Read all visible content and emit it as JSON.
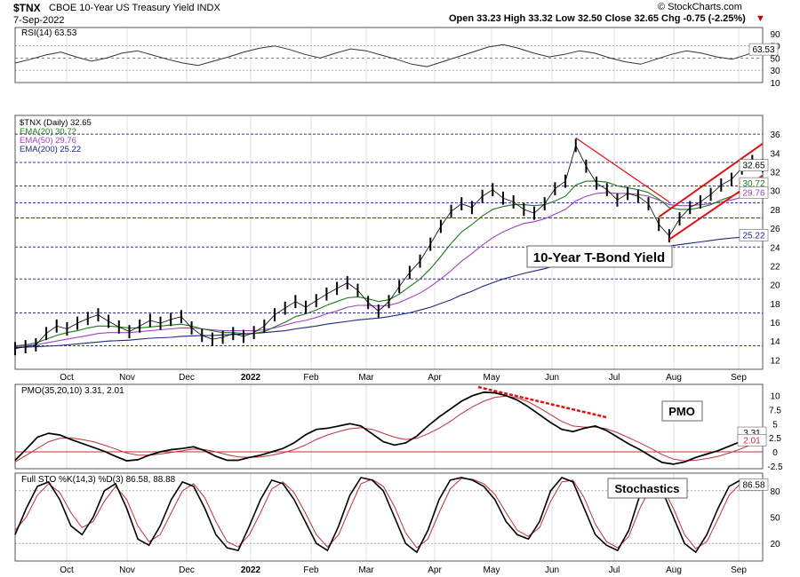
{
  "header": {
    "symbol": "$TNX",
    "description": "CBOE 10-Year US Treasury Yield INDX",
    "date": "7-Sep-2022",
    "ohlc_text": "Open 33.23  High 33.32  Low 32.50  Close 32.65  Chg -0.75 (-2.25%)",
    "credit": "© StockCharts.com",
    "down_arrow": "▼"
  },
  "colors": {
    "price": "#000000",
    "ema20": "#1a7a1a",
    "ema50": "#a040c0",
    "ema200": "#1c2a80",
    "pmo_signal": "#c0303a",
    "stoch_d": "#c0303a",
    "trend": "#e01010",
    "grid": "#333399"
  },
  "chart_data": [
    {
      "type": "line",
      "panel": "RSI",
      "label": "RSI(14) 63.53",
      "value": 63.53,
      "ylim": [
        10,
        100
      ],
      "yticks": [
        90,
        70,
        50,
        30,
        10
      ],
      "series": [
        {
          "name": "RSI(14)",
          "values": [
            42,
            48,
            55,
            60,
            52,
            45,
            50,
            58,
            62,
            55,
            48,
            42,
            38,
            45,
            52,
            60,
            66,
            70,
            64,
            56,
            50,
            58,
            65,
            62,
            55,
            48,
            40,
            36,
            44,
            52,
            60,
            68,
            72,
            66,
            58,
            52,
            56,
            62,
            58,
            50,
            44,
            40,
            48,
            56,
            62,
            58,
            52,
            48,
            56,
            63.53
          ]
        }
      ]
    },
    {
      "type": "line",
      "panel": "Price",
      "title": "10-Year T-Bond Yield",
      "ylim": [
        11,
        38
      ],
      "yticks": [
        36,
        34,
        32,
        30,
        28,
        26,
        24,
        22,
        20,
        18,
        16,
        14,
        12
      ],
      "legend": [
        {
          "label": "$TNX (Daily) 32.65",
          "color": "#000000"
        },
        {
          "label": "EMA(20) 30.72",
          "color": "#1a7a1a"
        },
        {
          "label": "EMA(50) 29.76",
          "color": "#a040c0"
        },
        {
          "label": "EMA(200) 25.22",
          "color": "#1c2a80"
        }
      ],
      "x_labels": [
        "Oct",
        "Nov",
        "Dec",
        "2022",
        "Feb",
        "Mar",
        "Apr",
        "May",
        "Jun",
        "Jul",
        "Aug",
        "Sep"
      ],
      "last_value_labels": [
        "32.65",
        "30.72",
        "29.76",
        "25.22"
      ],
      "series": [
        {
          "name": "$TNX",
          "values": [
            13.2,
            13.4,
            13.6,
            14.8,
            15.6,
            15.3,
            15.9,
            16.4,
            16.8,
            16.1,
            15.5,
            15.0,
            15.6,
            16.2,
            15.9,
            16.3,
            16.6,
            15.4,
            14.6,
            14.2,
            14.4,
            14.8,
            14.5,
            14.9,
            15.6,
            16.8,
            17.5,
            18.2,
            17.6,
            18.3,
            19.0,
            19.6,
            20.2,
            19.4,
            18.1,
            17.2,
            18.2,
            19.8,
            21.3,
            22.5,
            24.3,
            26.2,
            27.8,
            28.6,
            28.2,
            29.4,
            30.1,
            29.2,
            28.8,
            28.0,
            27.6,
            28.6,
            30.2,
            31.0,
            34.8,
            32.6,
            30.8,
            30.1,
            29.0,
            29.7,
            29.4,
            28.6,
            26.4,
            25.2,
            27.0,
            28.2,
            28.8,
            29.6,
            30.6,
            31.2,
            32.4,
            33.1,
            32.65
          ]
        },
        {
          "name": "EMA(20)",
          "values": [
            13.5,
            13.6,
            13.8,
            14.2,
            14.6,
            14.9,
            15.1,
            15.4,
            15.6,
            15.6,
            15.5,
            15.4,
            15.4,
            15.5,
            15.6,
            15.7,
            15.8,
            15.6,
            15.3,
            15.1,
            14.9,
            14.9,
            14.8,
            14.8,
            15.0,
            15.5,
            16.0,
            16.6,
            16.9,
            17.3,
            17.8,
            18.2,
            18.6,
            18.7,
            18.5,
            18.2,
            18.4,
            19.0,
            19.8,
            20.6,
            21.7,
            23.0,
            24.4,
            25.6,
            26.4,
            27.3,
            28.0,
            28.3,
            28.5,
            28.5,
            28.4,
            28.5,
            28.9,
            29.4,
            30.6,
            31.0,
            31.0,
            30.9,
            30.5,
            30.3,
            30.1,
            29.8,
            29.1,
            28.2,
            28.0,
            28.0,
            28.2,
            28.5,
            29.0,
            29.4,
            29.9,
            30.4,
            30.72
          ]
        },
        {
          "name": "EMA(50)",
          "values": [
            13.4,
            13.5,
            13.6,
            13.8,
            14.0,
            14.2,
            14.4,
            14.6,
            14.8,
            14.9,
            14.9,
            14.9,
            15.0,
            15.1,
            15.2,
            15.3,
            15.4,
            15.4,
            15.3,
            15.2,
            15.1,
            15.1,
            15.1,
            15.1,
            15.2,
            15.4,
            15.7,
            16.0,
            16.2,
            16.5,
            16.9,
            17.2,
            17.6,
            17.8,
            17.8,
            17.7,
            17.8,
            18.1,
            18.6,
            19.1,
            19.8,
            20.6,
            21.5,
            22.5,
            23.3,
            24.2,
            25.0,
            25.6,
            26.1,
            26.5,
            26.7,
            27.0,
            27.5,
            28.0,
            28.9,
            29.4,
            29.7,
            29.8,
            29.7,
            29.7,
            29.6,
            29.4,
            29.0,
            28.5,
            28.4,
            28.4,
            28.5,
            28.6,
            28.8,
            29.0,
            29.3,
            29.6,
            29.76
          ]
        },
        {
          "name": "EMA(200)",
          "values": [
            13.3,
            13.35,
            13.4,
            13.45,
            13.5,
            13.6,
            13.7,
            13.8,
            13.9,
            14.0,
            14.05,
            14.1,
            14.2,
            14.3,
            14.35,
            14.4,
            14.5,
            14.55,
            14.6,
            14.6,
            14.65,
            14.7,
            14.75,
            14.8,
            14.9,
            15.0,
            15.1,
            15.3,
            15.45,
            15.6,
            15.8,
            15.95,
            16.1,
            16.25,
            16.35,
            16.45,
            16.6,
            16.8,
            17.0,
            17.3,
            17.6,
            18.0,
            18.4,
            18.9,
            19.3,
            19.8,
            20.2,
            20.6,
            20.9,
            21.2,
            21.45,
            21.7,
            22.0,
            22.3,
            22.7,
            23.0,
            23.2,
            23.4,
            23.55,
            23.7,
            23.85,
            23.95,
            24.05,
            24.1,
            24.25,
            24.4,
            24.55,
            24.7,
            24.85,
            24.95,
            25.05,
            25.15,
            25.22
          ]
        }
      ],
      "annotations": [
        {
          "text": "10-Year T-Bond Yield"
        }
      ]
    },
    {
      "type": "line",
      "panel": "PMO",
      "label": "PMO(35,20,10) 3.31, 2.01",
      "title": "PMO",
      "ylim": [
        -3,
        12
      ],
      "yticks": [
        10.0,
        7.5,
        5.0,
        2.5,
        0.0,
        -2.5
      ],
      "last_value_labels": [
        "3.31",
        "2.01"
      ],
      "series": [
        {
          "name": "PMO",
          "values": [
            -1.5,
            0.5,
            2.6,
            3.3,
            3.0,
            2.2,
            1.5,
            0.8,
            0.1,
            -0.8,
            -1.6,
            -1.4,
            -0.6,
            0.0,
            0.4,
            0.6,
            0.9,
            0.2,
            -0.8,
            -1.5,
            -1.5,
            -1.0,
            -0.6,
            0.0,
            0.6,
            1.6,
            3.0,
            4.0,
            4.2,
            4.6,
            5.0,
            4.6,
            3.2,
            1.8,
            1.2,
            1.6,
            2.8,
            4.6,
            6.2,
            7.6,
            9.0,
            10.0,
            10.6,
            10.5,
            10.0,
            9.2,
            8.0,
            6.6,
            5.2,
            4.0,
            3.6,
            4.2,
            4.6,
            3.8,
            2.6,
            1.4,
            0.4,
            -0.8,
            -1.9,
            -2.2,
            -1.8,
            -1.0,
            -0.4,
            0.2,
            1.0,
            1.8,
            2.6,
            3.31
          ]
        },
        {
          "name": "Signal",
          "values": [
            -1.8,
            -0.6,
            0.6,
            1.8,
            2.4,
            2.5,
            2.2,
            1.8,
            1.2,
            0.5,
            -0.2,
            -0.6,
            -0.6,
            -0.4,
            -0.1,
            0.2,
            0.5,
            0.4,
            0.0,
            -0.5,
            -0.9,
            -1.0,
            -0.9,
            -0.6,
            -0.2,
            0.4,
            1.2,
            2.2,
            3.0,
            3.6,
            4.1,
            4.3,
            4.0,
            3.3,
            2.6,
            2.2,
            2.4,
            3.2,
            4.2,
            5.4,
            6.8,
            8.0,
            9.0,
            9.7,
            9.9,
            9.6,
            8.9,
            7.8,
            6.6,
            5.4,
            4.6,
            4.4,
            4.4,
            4.1,
            3.4,
            2.5,
            1.6,
            0.6,
            -0.5,
            -1.3,
            -1.6,
            -1.5,
            -1.2,
            -0.8,
            -0.2,
            0.5,
            1.3,
            2.01
          ]
        }
      ]
    },
    {
      "type": "line",
      "panel": "Stochastics",
      "label": "Full STO %K(14,3) %D(3) 86.58, 88.88",
      "title": "Stochastics",
      "ylim": [
        0,
        100
      ],
      "yticks": [
        80,
        50,
        20
      ],
      "last_value_labels": [
        "86.58"
      ],
      "series": [
        {
          "name": "%K",
          "values": [
            30,
            60,
            85,
            90,
            70,
            40,
            30,
            50,
            80,
            88,
            60,
            25,
            18,
            40,
            70,
            90,
            85,
            60,
            30,
            15,
            12,
            40,
            70,
            92,
            88,
            70,
            45,
            20,
            12,
            40,
            75,
            95,
            92,
            80,
            50,
            20,
            10,
            35,
            70,
            92,
            95,
            92,
            85,
            70,
            45,
            30,
            25,
            45,
            80,
            95,
            90,
            60,
            30,
            18,
            12,
            35,
            75,
            92,
            80,
            50,
            20,
            10,
            30,
            60,
            85,
            92,
            88,
            86.58
          ]
        },
        {
          "name": "%D",
          "values": [
            35,
            50,
            75,
            88,
            78,
            55,
            38,
            45,
            68,
            85,
            70,
            40,
            22,
            30,
            55,
            80,
            88,
            72,
            45,
            22,
            16,
            30,
            55,
            82,
            90,
            78,
            55,
            30,
            16,
            30,
            60,
            88,
            93,
            85,
            62,
            32,
            15,
            25,
            55,
            82,
            94,
            93,
            88,
            76,
            55,
            35,
            28,
            38,
            68,
            90,
            92,
            72,
            42,
            22,
            15,
            28,
            60,
            85,
            84,
            60,
            30,
            14,
            22,
            48,
            75,
            88,
            90,
            88.88
          ]
        }
      ]
    }
  ]
}
